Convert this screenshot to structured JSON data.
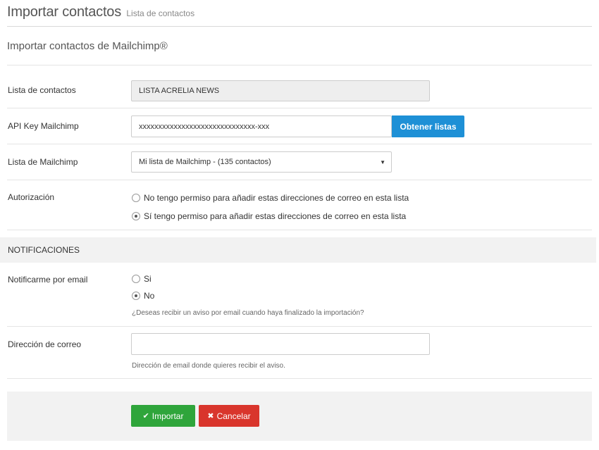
{
  "header": {
    "title": "Importar contactos",
    "subtitle": "Lista de contactos"
  },
  "section": {
    "title": "Importar contactos de Mailchimp®"
  },
  "form": {
    "contact_list": {
      "label": "Lista de contactos",
      "value": "LISTA ACRELIA NEWS"
    },
    "api_key": {
      "label": "API Key Mailchimp",
      "value": "xxxxxxxxxxxxxxxxxxxxxxxxxxxxxx-xxx",
      "button_label": "Obtener listas"
    },
    "mailchimp_list": {
      "label": "Lista de Mailchimp",
      "selected": "Mi lista de Mailchimp - (135 contactos)"
    },
    "authorization": {
      "label": "Autorización",
      "options": [
        {
          "label": "No tengo permiso para añadir estas direcciones de correo en esta lista",
          "checked": false
        },
        {
          "label": "Sí tengo permiso para añadir estas direcciones de correo en esta lista",
          "checked": true
        }
      ]
    }
  },
  "notifications": {
    "heading": "NOTIFICACIONES",
    "notify_email": {
      "label": "Notificarme por email",
      "options": [
        {
          "label": "Si",
          "checked": false
        },
        {
          "label": "No",
          "checked": true
        }
      ],
      "help": "¿Deseas recibir un aviso por email cuando haya finalizado la importación?"
    },
    "email_address": {
      "label": "Dirección de correo",
      "value": "",
      "help": "Dirección de email donde quieres recibir el aviso."
    }
  },
  "actions": {
    "import_label": "Importar",
    "cancel_label": "Cancelar"
  },
  "colors": {
    "primary_blue": "#1e90d6",
    "import_green": "#2fa53b",
    "cancel_red": "#d9352c"
  },
  "icons": {
    "import": "check-icon",
    "cancel": "times-icon",
    "select": "caret-down-icon"
  }
}
